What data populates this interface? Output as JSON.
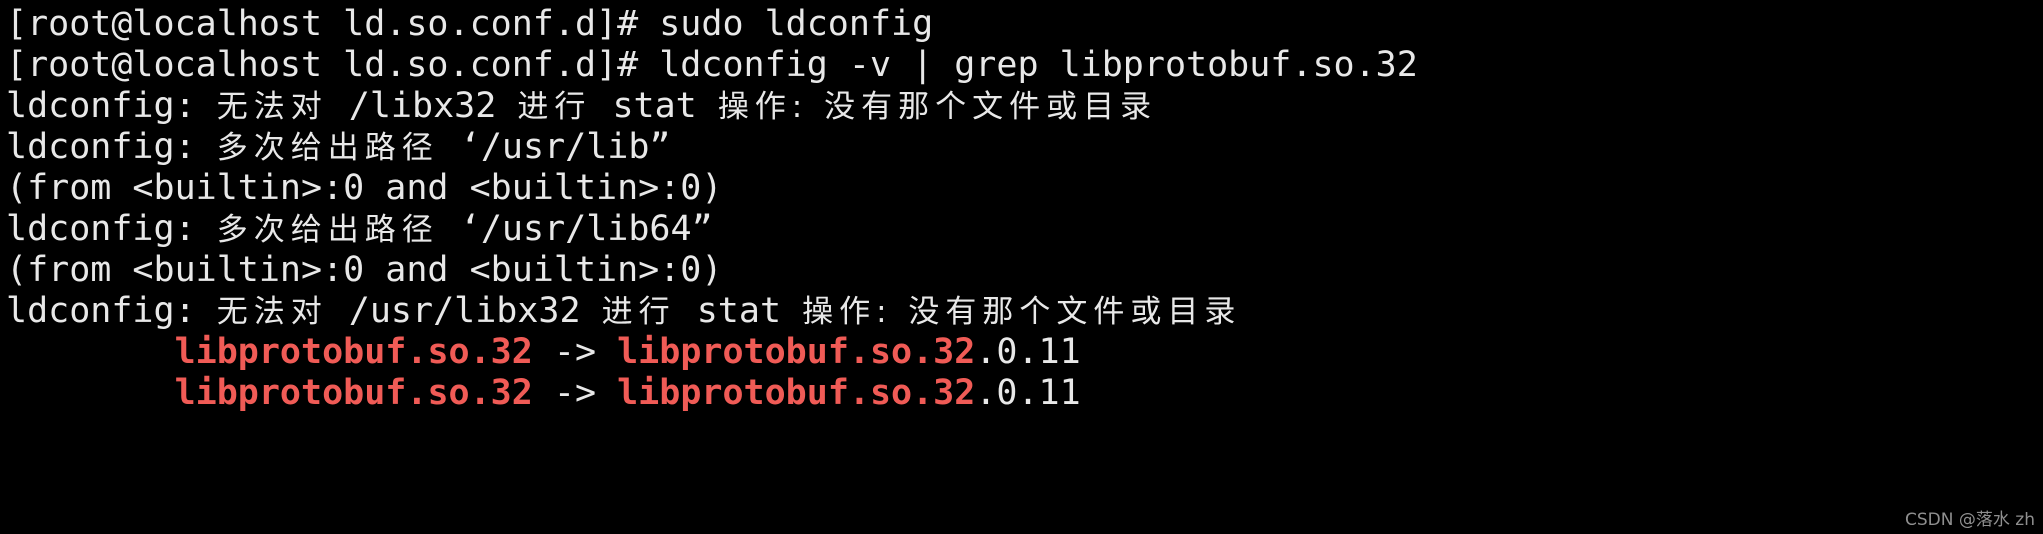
{
  "terminal": {
    "background_color": "#000000",
    "foreground_color": "#e8e8e8",
    "highlight_color": "#f05b56",
    "prompt": "[root@localhost ld.so.conf.d]# ",
    "lines": [
      {
        "id": "line-1-command",
        "segments": [
          {
            "text": "[root@localhost ld.so.conf.d]# sudo ldconfig",
            "style": "white"
          }
        ]
      },
      {
        "id": "line-2-command",
        "segments": [
          {
            "text": "[root@localhost ld.so.conf.d]# ldconfig -v | grep libprotobuf.so.32",
            "style": "white"
          }
        ]
      },
      {
        "id": "line-3-stat-error-libx32",
        "segments": [
          {
            "text": "ldconfig: ",
            "style": "white"
          },
          {
            "text": "无法对",
            "style": "cjk"
          },
          {
            "text": " /libx32 ",
            "style": "white"
          },
          {
            "text": "进行",
            "style": "cjk"
          },
          {
            "text": " stat ",
            "style": "white"
          },
          {
            "text": "操作: 没有那个文件或目录",
            "style": "cjk"
          }
        ]
      },
      {
        "id": "line-4-duplicate-path-usr-lib",
        "segments": [
          {
            "text": "ldconfig: ",
            "style": "white"
          },
          {
            "text": "多次给出路径",
            "style": "cjk"
          },
          {
            "text": " ‘/usr/lib”",
            "style": "white"
          }
        ]
      },
      {
        "id": "line-5-from-builtin",
        "segments": [
          {
            "text": "(from <builtin>:0 and <builtin>:0)",
            "style": "white"
          }
        ]
      },
      {
        "id": "line-6-duplicate-path-usr-lib64",
        "segments": [
          {
            "text": "ldconfig: ",
            "style": "white"
          },
          {
            "text": "多次给出路径",
            "style": "cjk"
          },
          {
            "text": " ‘/usr/lib64”",
            "style": "white"
          }
        ]
      },
      {
        "id": "line-7-from-builtin",
        "segments": [
          {
            "text": "(from <builtin>:0 and <builtin>:0)",
            "style": "white"
          }
        ]
      },
      {
        "id": "line-8-stat-error-usr-libx32",
        "segments": [
          {
            "text": "ldconfig: ",
            "style": "white"
          },
          {
            "text": "无法对",
            "style": "cjk"
          },
          {
            "text": " /usr/libx32 ",
            "style": "white"
          },
          {
            "text": "进行",
            "style": "cjk"
          },
          {
            "text": " stat ",
            "style": "white"
          },
          {
            "text": "操作: 没有那个文件或目录",
            "style": "cjk"
          }
        ]
      },
      {
        "id": "line-9-grep-match",
        "segments": [
          {
            "text": "        ",
            "style": "white"
          },
          {
            "text": "libprotobuf.so.32",
            "style": "red"
          },
          {
            "text": " -> ",
            "style": "white"
          },
          {
            "text": "libprotobuf.so.32",
            "style": "red"
          },
          {
            "text": ".0.11",
            "style": "white"
          }
        ]
      },
      {
        "id": "line-10-grep-match",
        "segments": [
          {
            "text": "        ",
            "style": "white"
          },
          {
            "text": "libprotobuf.so.32",
            "style": "red"
          },
          {
            "text": " -> ",
            "style": "white"
          },
          {
            "text": "libprotobuf.so.32",
            "style": "red"
          },
          {
            "text": ".0.11",
            "style": "white"
          }
        ]
      }
    ]
  },
  "watermark": {
    "text": "CSDN @落水 zh"
  }
}
